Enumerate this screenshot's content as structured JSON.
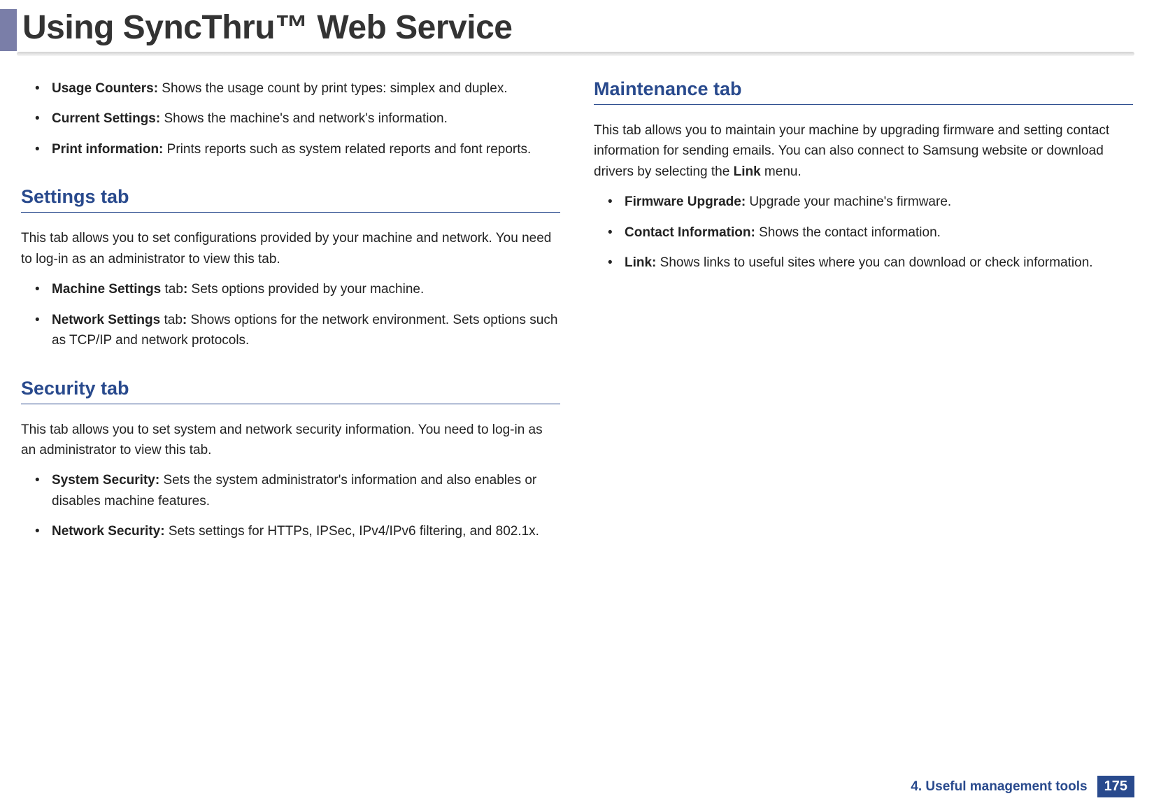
{
  "header": {
    "title": "Using SyncThru™ Web Service"
  },
  "left": {
    "top_list": [
      {
        "term": "Usage Counters:",
        "desc": " Shows the usage count by print types: simplex and duplex."
      },
      {
        "term": "Current Settings:",
        "desc": " Shows the machine's and network's information."
      },
      {
        "term": "Print information:",
        "desc": " Prints reports such as system related reports and font reports."
      }
    ],
    "settings": {
      "heading": "Settings tab",
      "intro": "This tab allows you to set configurations provided by your machine and network. You need to log-in as an administrator to view this tab.",
      "items": [
        {
          "term": "Machine Settings",
          "mid": " tab",
          "colon": ":",
          "desc": " Sets options provided by your machine."
        },
        {
          "term": "Network Settings",
          "mid": " tab",
          "colon": ":",
          "desc": " Shows options for the network environment. Sets options such as TCP/IP and network protocols."
        }
      ]
    },
    "security": {
      "heading": "Security tab",
      "intro": "This tab allows you to set system and network security information. You need to log-in as an administrator to view this tab.",
      "items": [
        {
          "term": "System Security:",
          "desc": " Sets the system administrator's information and also enables or disables machine features."
        },
        {
          "term": "Network Security:",
          "desc": " Sets settings for HTTPs, IPSec, IPv4/IPv6 filtering, and 802.1x."
        }
      ]
    }
  },
  "right": {
    "maintenance": {
      "heading": "Maintenance tab",
      "intro_pre": "This tab allows you to maintain your machine by upgrading firmware and setting contact information for sending emails. You can also connect to Samsung website or download drivers by selecting the ",
      "intro_bold": "Link",
      "intro_post": " menu.",
      "items": [
        {
          "term": "Firmware Upgrade:",
          "desc": " Upgrade your machine's firmware."
        },
        {
          "term": "Contact Information:",
          "desc": " Shows the contact information."
        },
        {
          "term": "Link:",
          "desc": " Shows links to useful sites where you can download or check information."
        }
      ]
    }
  },
  "footer": {
    "chapter": "4.  Useful management tools",
    "page": "175"
  }
}
